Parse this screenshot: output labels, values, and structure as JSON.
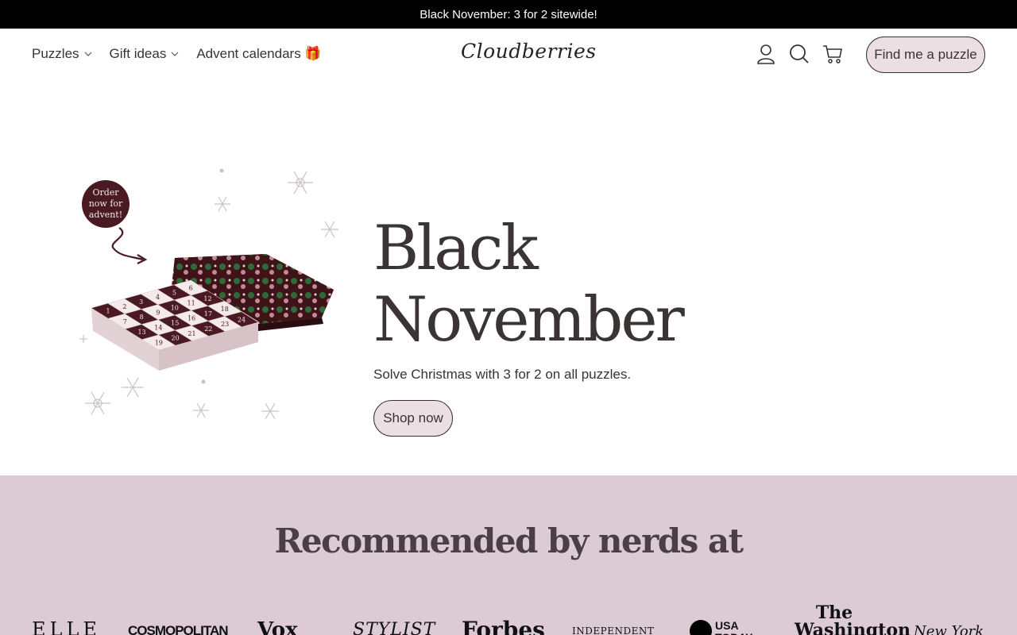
{
  "announcement": {
    "text": "Black November: 3 for 2 sitewide!"
  },
  "header": {
    "nav": [
      {
        "label": "Puzzles",
        "has_dropdown": true
      },
      {
        "label": "Gift ideas",
        "has_dropdown": true
      },
      {
        "label": "Advent calendars 🎁",
        "has_dropdown": false
      }
    ],
    "logo_text": "Cloudberries",
    "icons": [
      "account-icon",
      "search-icon",
      "cart-icon"
    ],
    "cta_label": "Find me a puzzle"
  },
  "hero": {
    "badge_line1": "Order",
    "badge_line2": "now for",
    "badge_line3": "advent!",
    "title": "Black November",
    "subtitle": "Solve Christmas with 3 for 2 on all puzzles.",
    "cta_label": "Shop now",
    "calendar_numbers": [
      "1",
      "2",
      "3",
      "4",
      "5",
      "6",
      "7",
      "8",
      "9",
      "10",
      "11",
      "12",
      "13",
      "14",
      "15",
      "16",
      "17",
      "18",
      "19",
      "20",
      "21",
      "22",
      "23",
      "24"
    ]
  },
  "press": {
    "title": "Recommended by nerds at",
    "logos": [
      "ELLE",
      "COSMOPOLITAN",
      "Vox",
      "STYLIST",
      "Forbes",
      "INDEPENDENT",
      "USA TODAY",
      "The Washington",
      "New York"
    ]
  },
  "colors": {
    "announcement_bg": "#000000",
    "button_fill": "#ecdfe3",
    "press_bg": "#dccbd4",
    "burgundy": "#4a1a22"
  }
}
